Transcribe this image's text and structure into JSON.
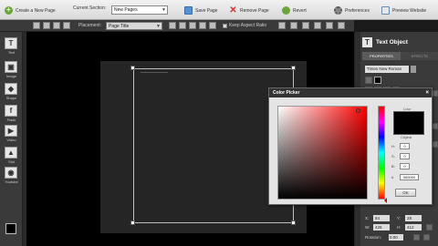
{
  "toolbar": {
    "create_page": "Create a New Page",
    "current_section_label": "Current Section:",
    "current_section_value": "New Pages",
    "save_page": "Save Page",
    "remove_page": "Remove Page",
    "revert": "Revert",
    "preferences": "Preferences",
    "preview_website": "Preview Website"
  },
  "subbar": {
    "placement_label": "Placement:",
    "placement_value": "Page Title",
    "keep_aspect": "Keep Aspect Ratio"
  },
  "tools": [
    {
      "icon": "T",
      "label": "Text"
    },
    {
      "icon": "▣",
      "label": "Image"
    },
    {
      "icon": "◆",
      "label": "Shape"
    },
    {
      "icon": "f",
      "label": "Flash"
    },
    {
      "icon": "▶",
      "label": "Video"
    },
    {
      "icon": "▲",
      "label": "Slot"
    },
    {
      "icon": "◉",
      "label": "Youtube"
    }
  ],
  "panel": {
    "title": "Text Object",
    "tab_properties": "PROPERTIES",
    "tab_effects": "EFFECTS",
    "font": "Times New Roman",
    "x_label": "X:",
    "x_value": "84",
    "y_label": "Y:",
    "y_value": "28",
    "w_label": "W:",
    "w_value": "425",
    "h_label": "H:",
    "h_value": "412",
    "rotation_label": "Rotation:",
    "rotation_value": "0.00"
  },
  "color_picker": {
    "title": "Color Picker",
    "preview_label": "Color",
    "original_label": "Original",
    "fields": [
      {
        "label": "H:",
        "value": "0"
      },
      {
        "label": "S:",
        "value": "0"
      },
      {
        "label": "B:",
        "value": "0"
      }
    ],
    "hex_label": "#",
    "hex_value": "000000",
    "ok": "OK",
    "current_color": "#000000",
    "hue_color": "#ff0000"
  }
}
